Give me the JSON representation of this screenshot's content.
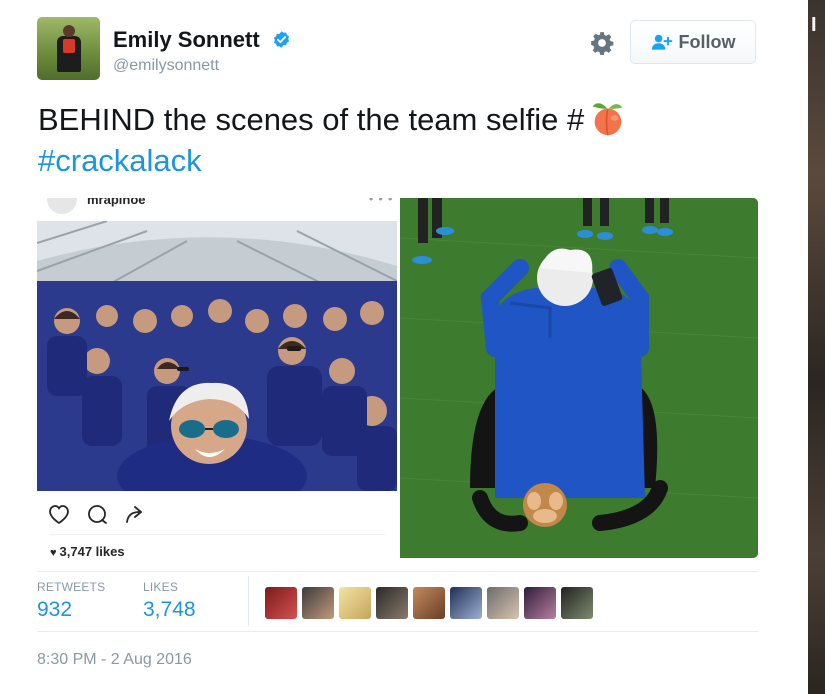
{
  "user": {
    "display_name": "Emily Sonnett",
    "handle": "@emilysonnett",
    "verified_icon": "verified-badge-icon",
    "avatar_icon": "profile-avatar"
  },
  "header": {
    "settings_icon": "gear-icon",
    "follow_label": "Follow",
    "follow_icon": "add-user-icon"
  },
  "tweet": {
    "text": "BEHIND the scenes of the team selfie  #",
    "emoji": "peach-emoji-icon",
    "hashtag": "#crackalack"
  },
  "media": {
    "instagram_post": {
      "username": "mrapinoe",
      "likes_count": "3,747 likes",
      "actions": [
        "heart-outline-icon",
        "comment-icon",
        "share-icon"
      ]
    }
  },
  "stats": {
    "retweets_label": "RETWEETS",
    "retweets_value": "932",
    "likes_label": "LIKES",
    "likes_value": "3,748",
    "liker_avatar_count": 9
  },
  "timestamp": "8:30 PM - 2 Aug 2016",
  "edge": {
    "visible_glyph": "I"
  },
  "colors": {
    "link": "#1b95e0",
    "muted": "#8899a6",
    "text": "#14171a",
    "verified": "#1da1f2"
  }
}
